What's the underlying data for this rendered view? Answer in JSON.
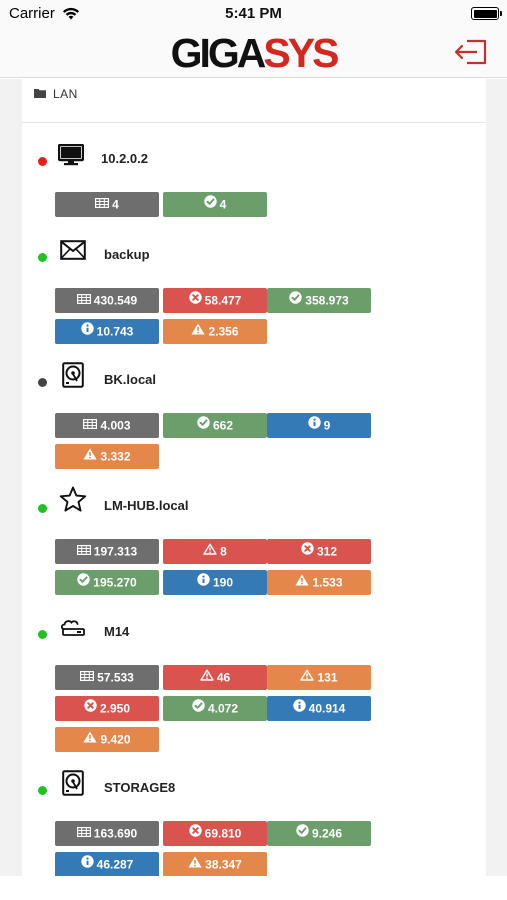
{
  "status_bar": {
    "carrier": "Carrier",
    "time": "5:41 PM"
  },
  "header": {
    "logo_part1": "GIGA",
    "logo_part2": "SYS",
    "logout_icon": "logout-icon"
  },
  "group": {
    "label": "LAN",
    "icon": "folder-icon"
  },
  "colors": {
    "gray": "#6e6e6e",
    "green": "#6b9e6b",
    "red": "#d9534f",
    "blue": "#337ab7",
    "orange": "#e3874a",
    "brand_red": "#d4271f"
  },
  "devices": [
    {
      "name": "10.2.0.2",
      "status": "red",
      "icon": "monitor-icon",
      "badges": [
        {
          "type": "total",
          "value": "4"
        },
        {
          "type": "ok",
          "value": "4"
        }
      ]
    },
    {
      "name": "backup",
      "status": "green",
      "icon": "envelope-icon",
      "badges": [
        {
          "type": "total",
          "value": "430.549"
        },
        {
          "type": "error",
          "value": "58.477"
        },
        {
          "type": "ok",
          "value": "358.973"
        },
        {
          "type": "info",
          "value": "10.743"
        },
        {
          "type": "warning",
          "value": "2.356"
        }
      ]
    },
    {
      "name": "BK.local",
      "status": "gray",
      "icon": "harddisk-icon",
      "badges": [
        {
          "type": "total",
          "value": "4.003"
        },
        {
          "type": "ok",
          "value": "662"
        },
        {
          "type": "info",
          "value": "9"
        },
        {
          "type": "warning",
          "value": "3.332"
        }
      ]
    },
    {
      "name": "LM-HUB.local",
      "status": "green",
      "icon": "star-icon",
      "badges": [
        {
          "type": "total",
          "value": "197.313"
        },
        {
          "type": "alert-red",
          "value": "8"
        },
        {
          "type": "error",
          "value": "312"
        },
        {
          "type": "ok",
          "value": "195.270"
        },
        {
          "type": "info",
          "value": "190"
        },
        {
          "type": "warning",
          "value": "1.533"
        }
      ]
    },
    {
      "name": "M14",
      "status": "green",
      "icon": "cloud-drive-icon",
      "badges": [
        {
          "type": "total",
          "value": "57.533"
        },
        {
          "type": "alert-red",
          "value": "46"
        },
        {
          "type": "alert-orange",
          "value": "131"
        },
        {
          "type": "error",
          "value": "2.950"
        },
        {
          "type": "ok",
          "value": "4.072"
        },
        {
          "type": "info",
          "value": "40.914"
        },
        {
          "type": "warning",
          "value": "9.420"
        }
      ]
    },
    {
      "name": "STORAGE8",
      "status": "green",
      "icon": "harddisk-icon",
      "badges": [
        {
          "type": "total",
          "value": "163.690"
        },
        {
          "type": "error",
          "value": "69.810"
        },
        {
          "type": "ok",
          "value": "9.246"
        },
        {
          "type": "info",
          "value": "46.287"
        },
        {
          "type": "warning",
          "value": "38.347"
        }
      ]
    }
  ]
}
